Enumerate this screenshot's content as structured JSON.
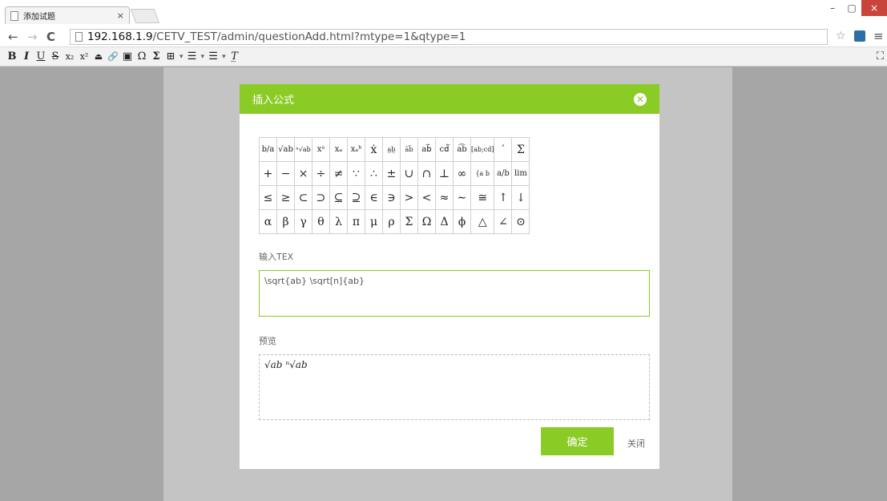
{
  "browser": {
    "tab_title": "添加试题",
    "tab_close": "×",
    "url_host": "192.168.1.9",
    "url_path": "/CETV_TEST/admin/questionAdd.html?mtype=1&qtype=1",
    "win_min": "–",
    "win_max": "▢",
    "win_close": "×",
    "back": "←",
    "forward": "→",
    "reload": "C",
    "star": "☆",
    "menu": "≡"
  },
  "toolbar": {
    "items": [
      "B",
      "I",
      "U",
      "S",
      "x₂",
      "x²",
      "⏏",
      "🔗",
      "▣",
      "Ω",
      "Σ",
      "⊞",
      "☰",
      "☰",
      "T̲"
    ],
    "maximize": "⛶"
  },
  "dialog": {
    "title": "插入公式",
    "close_icon": "✕",
    "symbols": [
      [
        "b/a",
        "√ab",
        "ⁿ√ab",
        "xᵃ",
        "xₐ",
        "xₐᵇ",
        "ẋ",
        "a̲b̲",
        "a̅b̅",
        "ab⃗",
        "cd⃖",
        "a͡b",
        "[ab;cd]",
        "′",
        "Σ"
      ],
      [
        "+",
        "−",
        "×",
        "÷",
        "≠",
        "∵",
        "∴",
        "±",
        "∪",
        "∩",
        "⊥",
        "∞",
        "{a b",
        "a/b",
        "lim"
      ],
      [
        "≤",
        "≥",
        "⊂",
        "⊃",
        "⊆",
        "⊇",
        "∈",
        "∋",
        ">",
        "<",
        "≈",
        "∼",
        "≅",
        "↑",
        "↓"
      ],
      [
        "α",
        "β",
        "γ",
        "θ",
        "λ",
        "π",
        "μ",
        "ρ",
        "Σ",
        "Ω",
        "Δ",
        "ϕ",
        "△",
        "∠",
        "⊙"
      ]
    ],
    "tex_label": "输入TEX",
    "tex_value": "\\sqrt{ab} \\sqrt[n]{ab}",
    "preview_label": "预览",
    "preview_value": "√ab ⁿ√ab",
    "confirm_label": "确定",
    "close_label": "关闭"
  }
}
